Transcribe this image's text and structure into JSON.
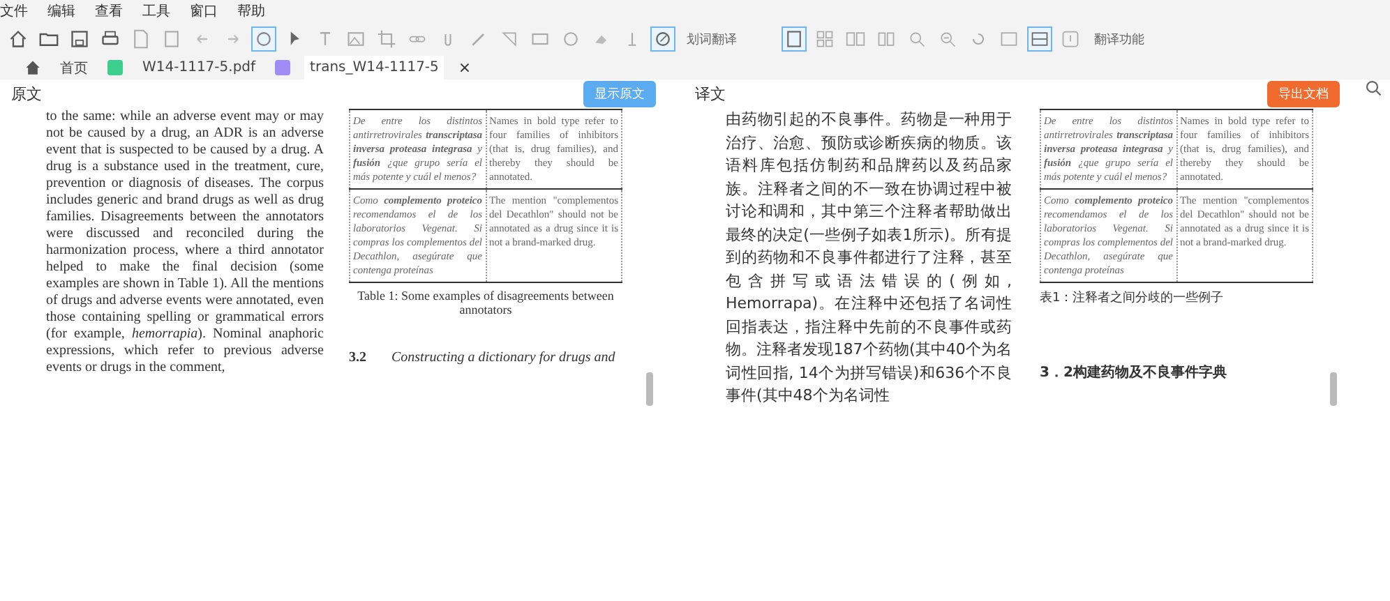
{
  "menu": [
    "文件",
    "编辑",
    "查看",
    "工具",
    "窗口",
    "帮助"
  ],
  "toolbar": {
    "tools": [
      {
        "selected": false
      },
      {
        "selected": false
      },
      {
        "selected": false
      },
      {
        "selected": false
      },
      {
        "selected": false
      },
      {
        "selected": false
      },
      {
        "selected": false
      },
      {
        "selected": false
      },
      {
        "selected": true
      },
      {
        "selected": false
      },
      {
        "selected": false
      },
      {
        "selected": false
      },
      {
        "selected": false
      },
      {
        "selected": false
      },
      {
        "selected": false
      },
      {
        "selected": false
      },
      {
        "selected": false
      },
      {
        "selected": false
      },
      {
        "selected": false
      },
      {
        "selected": false
      },
      {
        "selected": false
      },
      {
        "selected": true
      }
    ],
    "label_1": "划词翻译",
    "tools_2": [
      {
        "selected": true
      },
      {
        "selected": false
      },
      {
        "selected": false
      },
      {
        "selected": false
      },
      {
        "selected": false
      },
      {
        "selected": false
      },
      {
        "selected": false
      },
      {
        "selected": false
      },
      {
        "selected": true
      },
      {
        "selected": false
      }
    ],
    "label_2": "翻译功能"
  },
  "tabs": [
    {
      "label": "首页",
      "kind": "home",
      "selected": false
    },
    {
      "label": "W14-1117-5.pdf",
      "kind": "pdf",
      "selected": false
    },
    {
      "label": "trans_W14-1117-5",
      "kind": "trans",
      "selected": true,
      "close": "×"
    }
  ],
  "original": {
    "title": "原文",
    "button": "显示原文",
    "paragraph": "to the same: while an adverse event may or may not be caused by a drug, an ADR is an adverse event that is suspected to be caused by a drug. A drug is a substance used in the treatment, cure, prevention or diagnosis of diseases. The corpus includes generic and brand drugs as well as drug families. Disagreements between the annotators were discussed and reconciled during the harmonization process, where a third annotator helped to make the final decision (some examples are shown in Table 1). All the mentions of drugs and adverse events were annotated, even those containing spelling or grammatical errors (for example, *hemorrapia*). Nominal anaphoric expressions, which refer to previous adverse events or drugs in the comment,",
    "table": [
      [
        "De entre los distintos antirretrovirales **transcriptasa inversa proteasa integrasa** y **fusión** ¿que grupo sería el más potente y cuál el menos?",
        "Names in bold type refer to four families of inhibitors (that is, drug families), and thereby they should be annotated."
      ],
      [
        "Como **complemento proteico** recomendamos el de los laboratorios Vegenat. Si compras los complementos del Decathlon, asegúrate que contenga proteínas",
        "The mention \"complementos del Decathlon\" should not be annotated as a drug since it is not a brand-marked drug."
      ]
    ],
    "caption": "Table 1: Some examples of disagreements between annotators",
    "heading_number": "3.2",
    "heading": "Constructing a dictionary for drugs and"
  },
  "translation": {
    "title": "译文",
    "button": "导出文档",
    "paragraph": "由药物引起的不良事件。药物是一种用于治疗、治愈、预防或诊断疾病的物质。该语料库包括仿制药和品牌药以及药品家族。注释者之间的不一致在协调过程中被讨论和调和，其中第三个注释者帮助做出最终的决定(一些例子如表1所示)。所有提到的药物和不良事件都进行了注释，甚至包含拼写或语法错误的(例如, Hemorrapa)。在注释中还包括了名词性回指表达，指注释中先前的不良事件或药物。注释者发现187个药物(其中40个为名词性回指, 14个为拼写错误)和636个不良事件(其中48个为名词性",
    "table": [
      [
        "De entre los distintos antirretrovirales **transcriptasa inversa proteasa integrasa** y **fusión** ¿que grupo sería el más potente y cuál el menos?",
        "Names in bold type refer to four families of inhibitors (that is, drug families), and thereby they should be annotated."
      ],
      [
        "Como **complemento proteico** recomendamos el de los laboratorios Vegenat. Si compras los complementos del Decathlon, asegúrate que contenga proteínas",
        "The mention \"complementos del Decathlon\" should not be annotated as a drug since it is not a brand-marked drug."
      ]
    ],
    "caption": "表1：注释者之间分歧的一些例子",
    "heading": "3．2构建药物及不良事件字典"
  }
}
